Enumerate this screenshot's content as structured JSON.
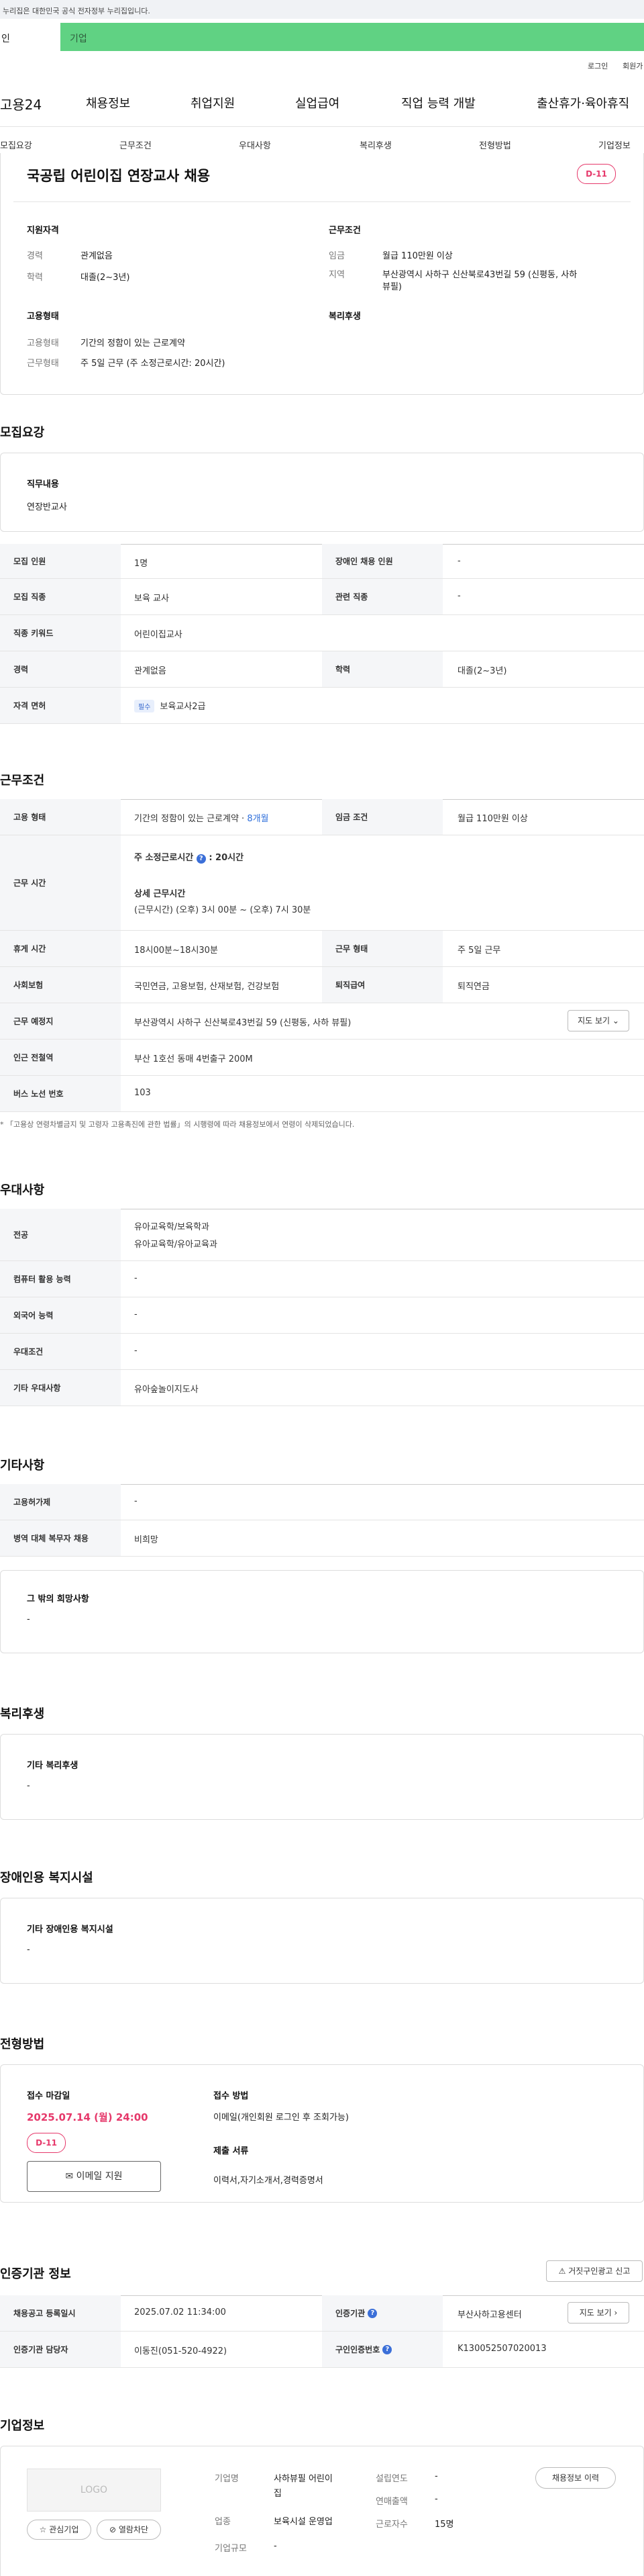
{
  "gov_banner": "누리집은 대한민국 공식 전자정부 누리집입니다.",
  "top_tabs": {
    "personal": "인",
    "company": "기업"
  },
  "util": {
    "login": "로그인",
    "join": "회원가"
  },
  "logo": "고용24",
  "gnb": [
    "채용정보",
    "취업지원",
    "실업급여",
    "직업 능력 개발",
    "출산휴가·육아휴직"
  ],
  "lnb": [
    "모집요강",
    "근무조건",
    "우대사항",
    "복리후생",
    "전형방법",
    "기업정보"
  ],
  "title": "국공립 어린이집 연장교사 채용",
  "dday": "D-11",
  "summary": {
    "qual_title": "지원자격",
    "career_k": "경력",
    "career_v": "관계없음",
    "edu_k": "학력",
    "edu_v": "대졸(2~3년)",
    "cond_title": "근무조건",
    "wage_k": "임금",
    "wage_v": "월급 110만원 이상",
    "area_k": "지역",
    "area_v1": "부산광역시 사하구 신산북로43번길 59 (신평동, 사하",
    "area_v2": "뷰필)",
    "emp_title": "고용형태",
    "emp_k": "고용형태",
    "emp_v": "기간의 정함이 있는 근로계약",
    "work_k": "근무형태",
    "work_v": "주 5일 근무 (주 소정근로시간: 20시간)",
    "welfare_title": "복리후생"
  },
  "recruit": {
    "section": "모집요강",
    "duty_title": "직무내용",
    "duty_v": "연장반교사",
    "rows": {
      "count_k": "모집 인원",
      "count_v": "1명",
      "disabled_k": "장애인 채용 인원",
      "disabled_v": "-",
      "job_k": "모집 직종",
      "job_v": "보육 교사",
      "rel_k": "관련 직종",
      "rel_v": "-",
      "kw_k": "직종 키워드",
      "kw_v": "어린이집교사",
      "career_k": "경력",
      "career_v": "관계없음",
      "edu_k": "학력",
      "edu_v": "대졸(2~3년)",
      "license_k": "자격 면허",
      "license_tag": "필수",
      "license_v": "보육교사2급"
    }
  },
  "work": {
    "section": "근무조건",
    "type_k": "고용 형태",
    "type_v": "기간의 정함이 있는 근로계약 · ",
    "type_months": "8개월",
    "wage_k": "임금 조건",
    "wage_v": "월급 110만원 이상",
    "time_k": "근무 시간",
    "time_l1": "주 소정근로시간",
    "time_l1v": ": 20시간",
    "time_l2": "상세 근무시간",
    "time_l3": "(근무시간) (오후) 3시 00분 ~ (오후) 7시 30분",
    "rest_k": "휴게 시간",
    "rest_v": "18시00분~18시30분",
    "form_k": "근무 형태",
    "form_v": "주 5일 근무",
    "ins_k": "사회보험",
    "ins_v": "국민연금, 고용보험, 산재보험, 건강보험",
    "ret_k": "퇴직급여",
    "ret_v": "퇴직연금",
    "place_k": "근무 예정지",
    "place_v": "부산광역시 사하구 신산북로43번길 59 (신평동, 사하 뷰필)",
    "map_btn": "지도 보기",
    "subway_k": "인근 전철역",
    "subway_v": "부산 1호선 동매 4번출구 200M",
    "bus_k": "버스 노선 번호",
    "bus_v": "103",
    "note": "* 「고용상 연령차별금지 및 고령자 고용촉진에 관한 법률」의 시행령에 따라 채용정보에서 연령이 삭제되었습니다."
  },
  "pref": {
    "section": "우대사항",
    "major_k": "전공",
    "major_v1": "유아교육학/보육학과",
    "major_v2": "유아교육학/유아교육과",
    "pc_k": "컴퓨터 활용 능력",
    "pc_v": "-",
    "lang_k": "외국어 능력",
    "lang_v": "-",
    "cond_k": "우대조건",
    "cond_v": "-",
    "etc_k": "기타 우대사항",
    "etc_v": "유아숲놀이지도사"
  },
  "other": {
    "section": "기타사항",
    "permit_k": "고용허가제",
    "permit_v": "-",
    "mil_k": "병역 대체 복무자 채용",
    "mil_v": "비희망",
    "hope_title": "그 밖의 희망사항",
    "hope_v": "-"
  },
  "welfare": {
    "section": "복리후생",
    "title": "기타 복리후생",
    "v": "-"
  },
  "dis": {
    "section": "장애인용 복지시설",
    "title": "기타 장애인용 복지시설",
    "v": "-"
  },
  "process": {
    "section": "전형방법",
    "deadline_k": "접수 마감일",
    "deadline_v": "2025.07.14 (월) 24:00",
    "dday": "D-11",
    "email_btn": "이메일 지원",
    "method_k": "접수 방법",
    "method_v": "이메일(개인회원 로그인 후 조회가능)",
    "docs_k": "제출 서류",
    "docs_v": "이력서,자기소개서,경력증명서"
  },
  "cert": {
    "section": "인증기관 정보",
    "report_btn": "거짓구인광고 신고",
    "reg_k": "채용공고 등록일시",
    "reg_v": "2025.07.02 11:34:00",
    "org_k": "인증기관",
    "org_v": "부산사하고용센터",
    "map_btn": "지도 보기",
    "mgr_k": "인증기관 담당자",
    "mgr_v": "이동진(051-520-4922)",
    "no_k": "구인인증번호",
    "no_v": "K130052507020013"
  },
  "company": {
    "section": "기업정보",
    "logo": "LOGO",
    "fav_btn": "관심기업",
    "block_btn": "열람차단",
    "name_k": "기업명",
    "name_v1": "사하뷰필 어린이",
    "name_v2": "집",
    "ind_k": "업종",
    "ind_v": "보육시설 운영업",
    "size_k": "기업규모",
    "size_v": "-",
    "est_k": "설립연도",
    "est_v": "-",
    "sales_k": "연매출액",
    "sales_v": "-",
    "emp_k": "근로자수",
    "emp_v": "15명",
    "history_btn": "채용정보 이력"
  }
}
